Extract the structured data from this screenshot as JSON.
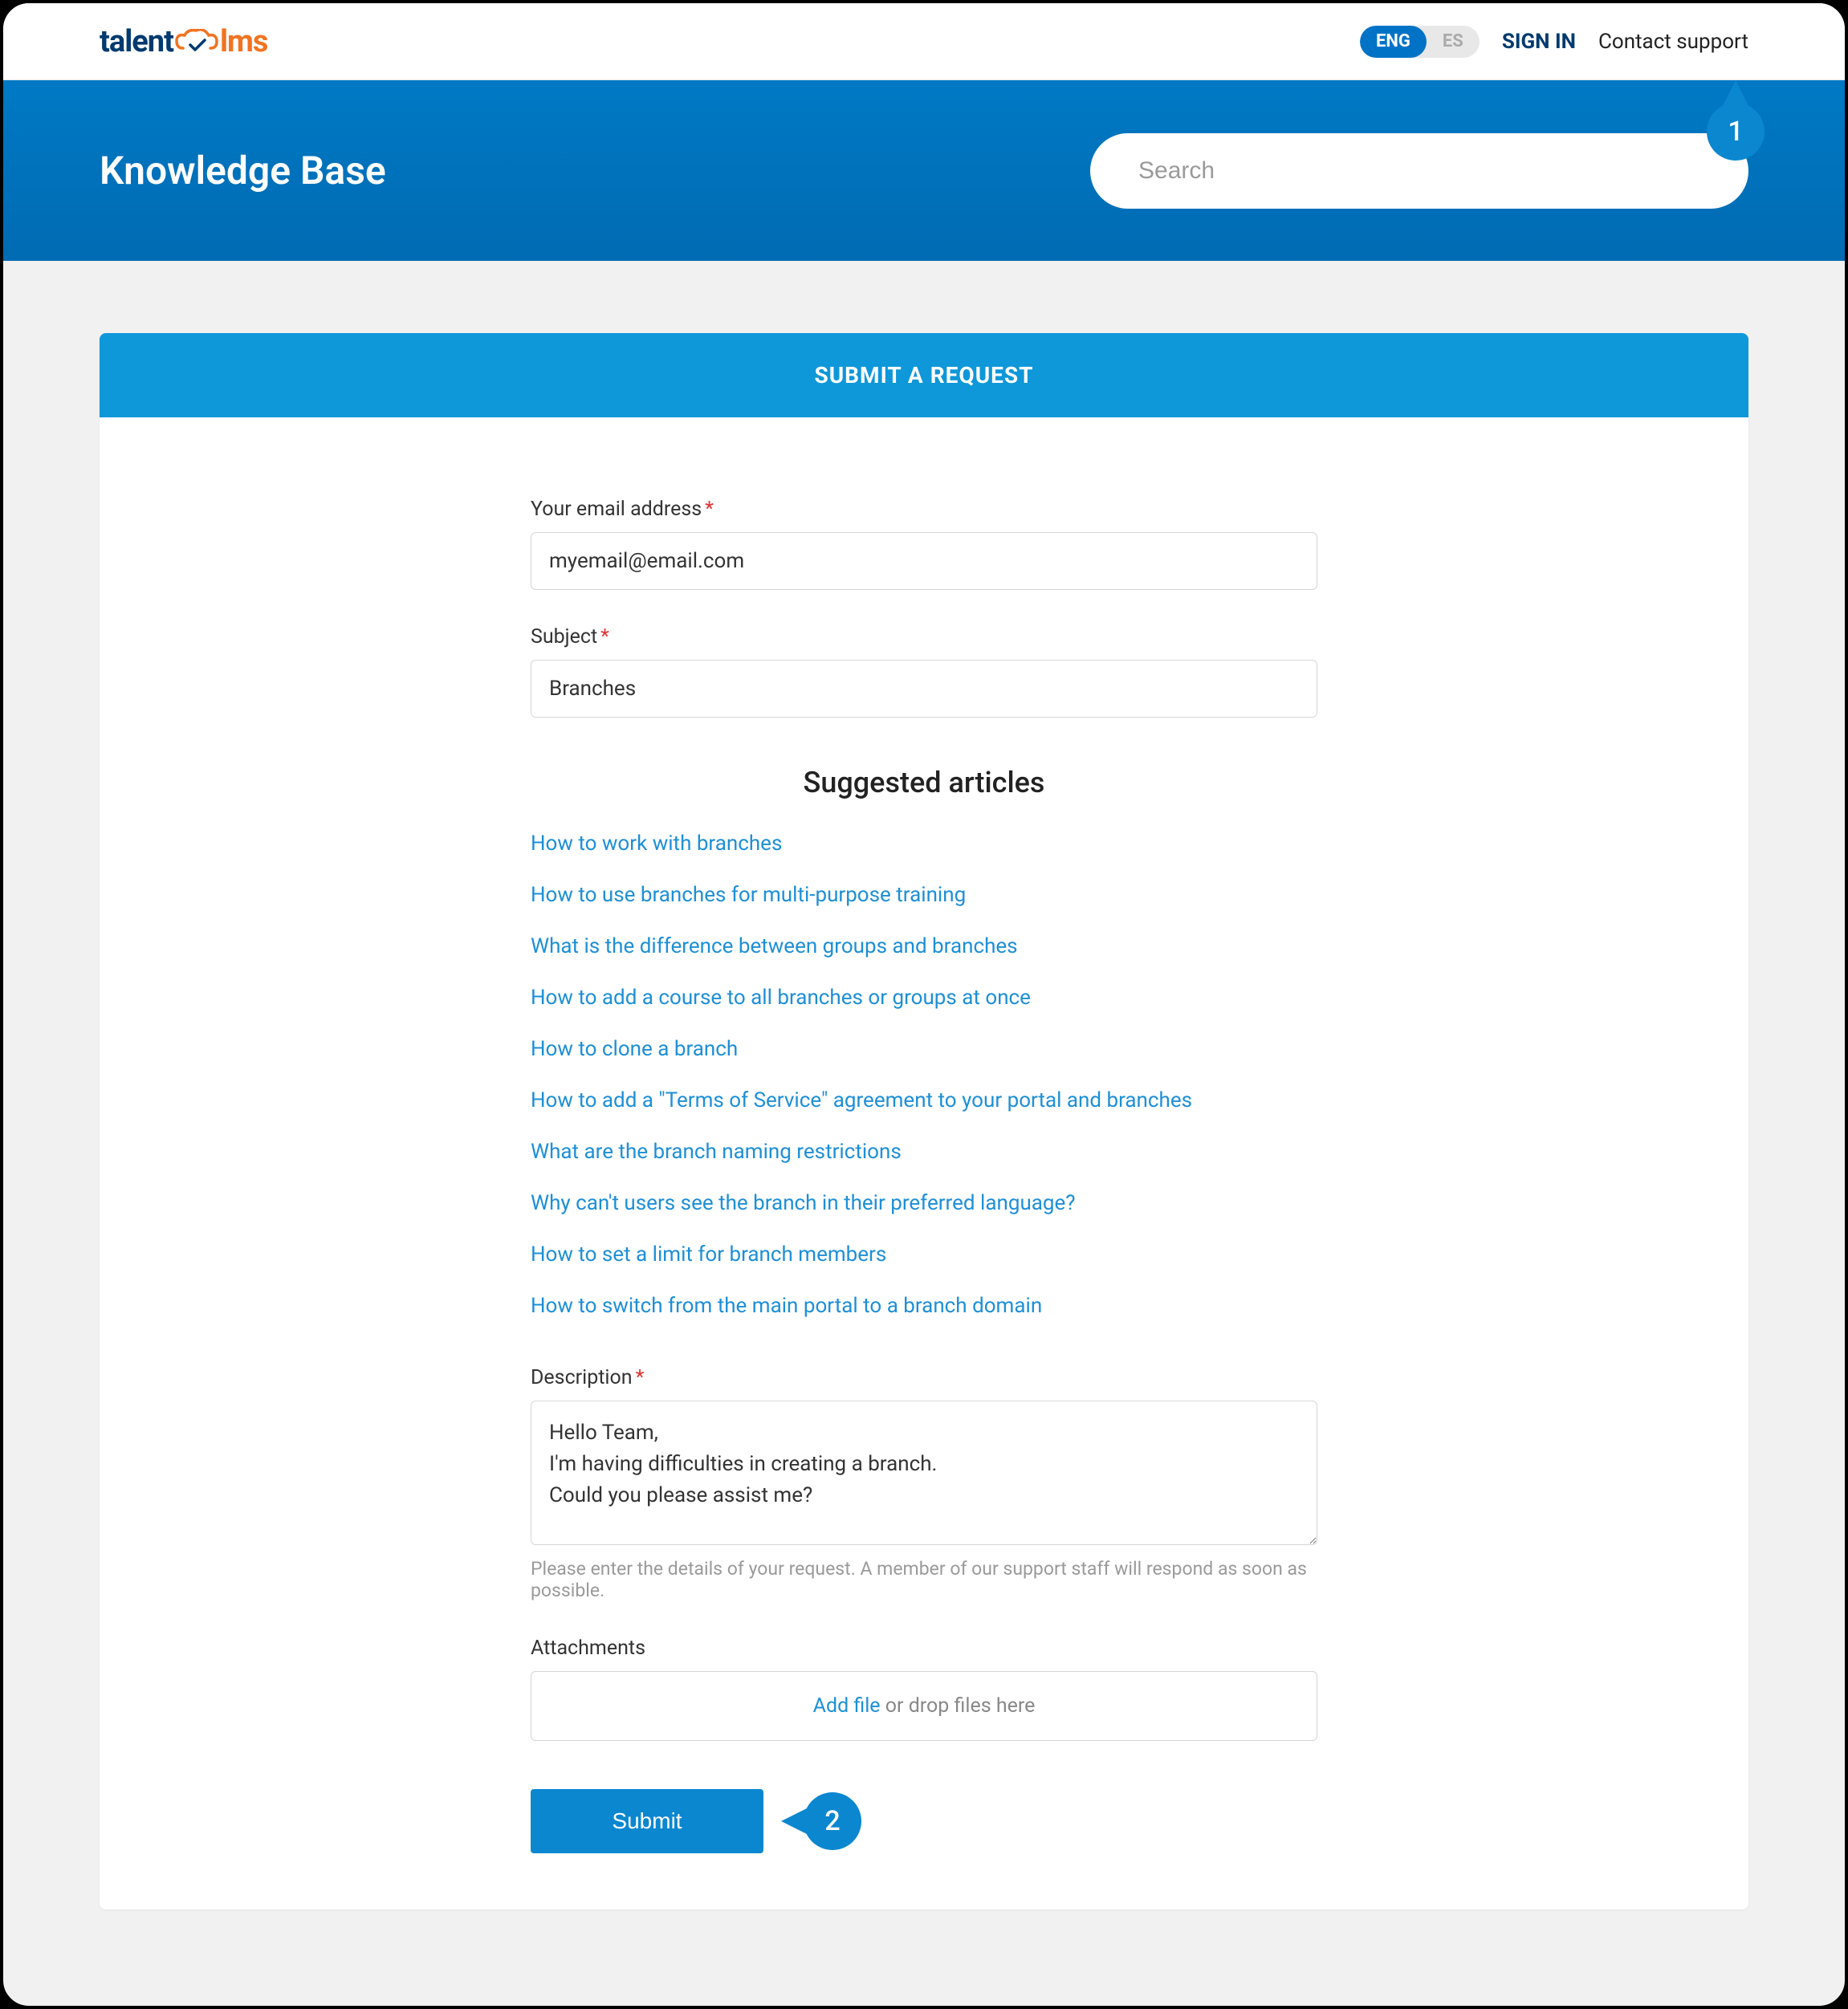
{
  "topnav": {
    "logo": {
      "text1": "talent",
      "text2": "lms"
    },
    "lang": {
      "active": "ENG",
      "inactive": "ES"
    },
    "signin": "SIGN IN",
    "contact": "Contact support"
  },
  "header": {
    "title": "Knowledge Base",
    "search_placeholder": "Search"
  },
  "card": {
    "title": "SUBMIT A REQUEST"
  },
  "form": {
    "email": {
      "label": "Your email address",
      "value": "myemail@email.com"
    },
    "subject": {
      "label": "Subject",
      "value": "Branches"
    },
    "suggested_title": "Suggested articles",
    "suggested": [
      "How to work with branches",
      "How to use branches for multi-purpose training",
      "What is the difference between groups and branches",
      "How to add a course to all branches or groups at once",
      "How to clone a branch",
      "How to add a \"Terms of Service\" agreement to your portal and branches",
      "What are the branch naming restrictions",
      "Why can't users see the branch in their preferred language?",
      "How to set a limit for branch members",
      "How to switch from the main portal to a branch domain"
    ],
    "description": {
      "label": "Description",
      "value": "Hello Team,\nI'm having difficulties in creating a branch.\nCould you please assist me?",
      "hint": "Please enter the details of your request. A member of our support staff will respond as soon as possible."
    },
    "attachments": {
      "label": "Attachments",
      "addfile": "Add file",
      "dropfiles": " or drop files here"
    },
    "submit": "Submit"
  },
  "annotations": {
    "b1": "1",
    "b2": "2"
  }
}
